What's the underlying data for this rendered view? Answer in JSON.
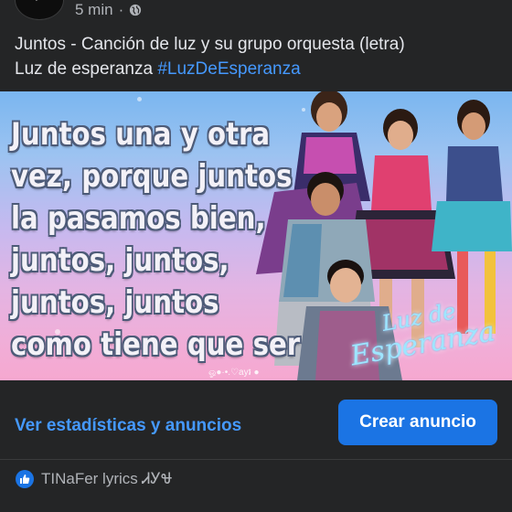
{
  "header": {
    "time": "5 min",
    "separator": "·",
    "privacy_icon": "globe-icon"
  },
  "post": {
    "text_line1": "Juntos - Canción de luz y su grupo orquesta (letra)",
    "text_line2_prefix": "Luz de esperanza ",
    "hashtag": "#LuzDeEsperanza"
  },
  "media": {
    "lyrics": [
      "Juntos una y otra",
      "vez, porque juntos",
      "la pasamos bien,",
      "juntos, juntos,",
      "juntos, juntos",
      "como tiene que ser"
    ],
    "watermark": "ஓ●·•.♡ay៛ ●",
    "logo_line1": "Luz de",
    "logo_line2": "Esperanza"
  },
  "actions": {
    "stats_link": "Ver estadísticas y anuncios",
    "create_ad_button": "Crear anuncio"
  },
  "reactions": {
    "icon": "like-icon",
    "names": "TINaFer lyrics ᏗᎩᏠ"
  },
  "colors": {
    "background": "#242526",
    "link_blue": "#4599ff",
    "button_blue": "#1b74e4",
    "text_primary": "#e4e6eb",
    "text_secondary": "#b0b3b8"
  }
}
